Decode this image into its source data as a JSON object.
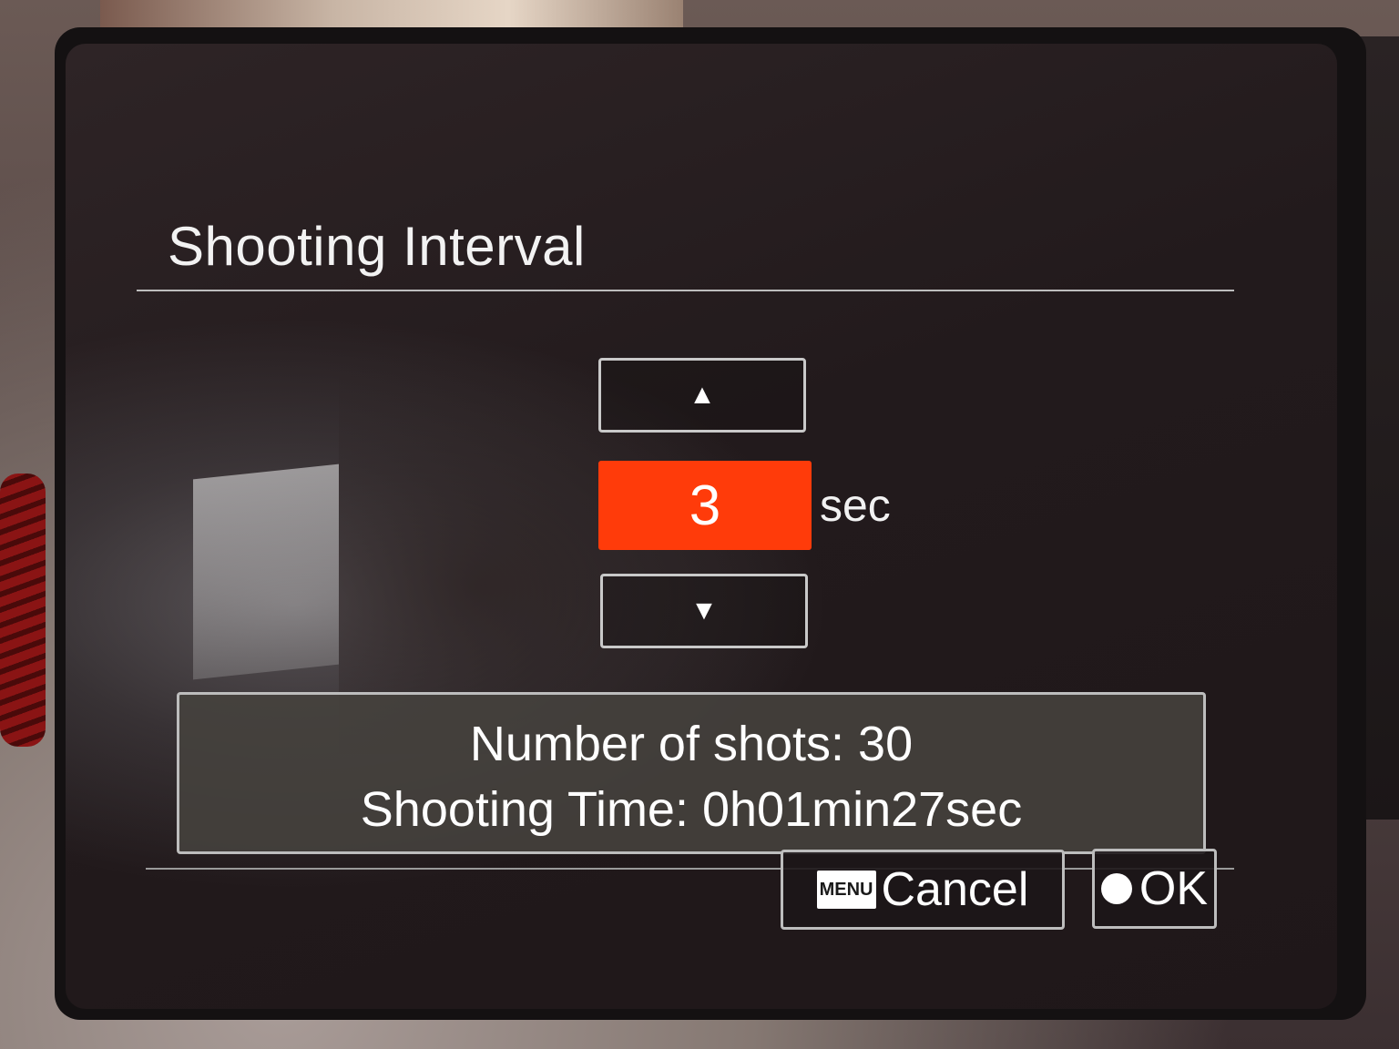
{
  "screen": {
    "title": "Shooting Interval"
  },
  "interval": {
    "up_symbol": "▲",
    "down_symbol": "▼",
    "value": "3",
    "unit": "sec",
    "highlight_color": "#ff3b0a"
  },
  "info": {
    "shots_line": "Number of shots: 30",
    "time_line": "Shooting Time: 0h01min27sec"
  },
  "buttons": {
    "cancel_key": "MENU",
    "cancel_label": "Cancel",
    "ok_label": "OK"
  }
}
